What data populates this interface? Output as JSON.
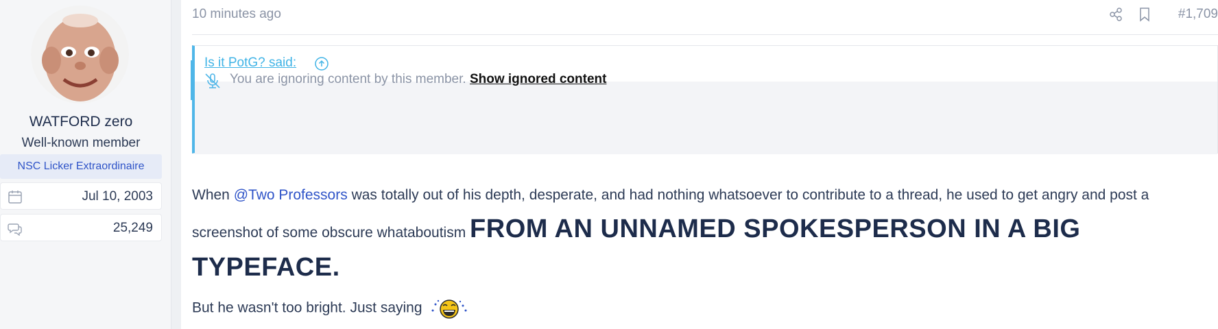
{
  "user": {
    "name": "WATFORD zero",
    "title": "Well-known member",
    "banner": "NSC Licker Extraordinaire",
    "joined": "Jul 10, 2003",
    "messages": "25,249",
    "avatar_icon": "avatar-face"
  },
  "post": {
    "time": "10 minutes ago",
    "number": "#1,709",
    "icons": [
      "share-icon",
      "bookmark-icon"
    ]
  },
  "quote": {
    "author": "Is it PotG? said:",
    "ignored_text": "You are ignoring content by this member.",
    "ignored_link": "Show ignored content"
  },
  "message": {
    "part1": "When ",
    "mention": "@Two Professors",
    "part2": " was totally out of his depth, desperate, and had nothing whatsoever to contribute to a thread, he used to get angry and post a screenshot of some obscure whataboutism ",
    "big": "FROM AN UNNAMED SPOKESPERSON IN A BIG TYPEFACE.",
    "line2": "But he wasn't too bright. Just saying",
    "emoji": "laughing-emoji"
  },
  "colors": {
    "accent": "#4fb6e8",
    "link": "#2f54c8",
    "text": "#1d2c4b",
    "muted": "#8a93a5"
  }
}
